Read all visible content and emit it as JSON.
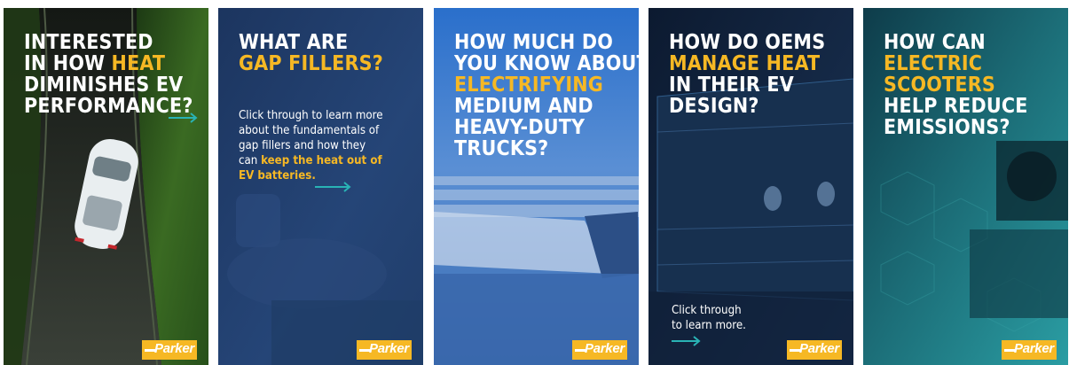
{
  "cards": [
    {
      "title": "Interested in how heat diminishes EV performance card",
      "lines": [
        "INTERESTED",
        "IN HOW ",
        "HEAT",
        "DIMINISHES EV",
        "PERFORMANCE?"
      ],
      "colors": {
        "bg_top": "#0f1a0e",
        "bg_bottom": "#1f2b1a",
        "accent": "#29b3b5"
      },
      "logo": "Parker"
    },
    {
      "lines": [
        "WHAT ARE",
        "GAP FILLERS?"
      ],
      "body": [
        "Click through to learn more",
        "about the fundamentals of",
        "gap fillers and how they",
        "can ",
        "keep the heat out of",
        "EV batteries."
      ],
      "colors": {
        "bg_top": "#1f3a66",
        "bg_bottom": "#233f6a",
        "accent": "#29b3b5"
      },
      "logo": "Parker"
    },
    {
      "lines": [
        "HOW MUCH DO",
        "YOU KNOW ABOUT",
        "ELECTRIFYING",
        "MEDIUM AND",
        "HEAVY-DUTY",
        "TRUCKS?"
      ],
      "colors": {
        "bg_top": "#2a6fc9",
        "bg_bottom": "#3b6fb3"
      },
      "logo": "Parker"
    },
    {
      "lines": [
        "HOW DO OEMs",
        "MANAGE HEAT",
        "IN THEIR EV",
        "DESIGN?"
      ],
      "body": [
        "Click through",
        "to learn more."
      ],
      "colors": {
        "bg_top": "#0d1c33",
        "bg_bottom": "#1a2f4f",
        "accent": "#29b3b5"
      },
      "logo": "Parker"
    },
    {
      "lines": [
        "HOW CAN",
        "ELECTRIC",
        "SCOOTERS",
        "HELP REDUCE",
        "EMISSIONS?"
      ],
      "colors": {
        "bg_top": "#0f3f4a",
        "bg_bottom": "#2a9aa0"
      },
      "logo": "Parker"
    }
  ]
}
